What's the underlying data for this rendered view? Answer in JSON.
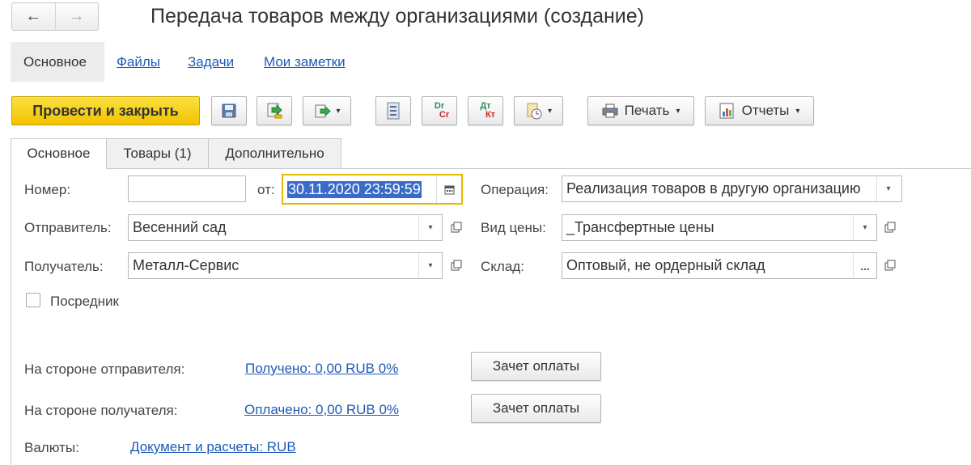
{
  "window": {
    "title": "Передача товаров между организациями (создание)",
    "nav": {
      "back_icon": "←",
      "forward_icon": "→"
    }
  },
  "section_tabs": [
    {
      "label": "Основное",
      "active": true
    },
    {
      "label": "Файлы"
    },
    {
      "label": "Задачи"
    },
    {
      "label": "Мои заметки"
    }
  ],
  "toolbar": {
    "post_close_label": "Провести и закрыть",
    "print_label": "Печать",
    "reports_label": "Отчеты",
    "dt_kt_top": "Dr",
    "dt_kt_bottom": "Cr",
    "dt_kt2_top": "Дт",
    "dt_kt2_bottom": "Кт",
    "dropdown_glyph": "▾",
    "colors": {
      "primary": "#f5c800",
      "dt": "#2e8b57",
      "kt": "#cc2222"
    }
  },
  "tabs": [
    {
      "label": "Основное",
      "active": true
    },
    {
      "label": "Товары (1)"
    },
    {
      "label": "Дополнительно"
    }
  ],
  "form": {
    "number": {
      "label": "Номер:",
      "value": ""
    },
    "date": {
      "label": "от:",
      "value": "30.11.2020 23:59:59"
    },
    "operation": {
      "label": "Операция:",
      "value": "Реализация товаров в другую организацию"
    },
    "sender": {
      "label": "Отправитель:",
      "value": "Весенний сад"
    },
    "price_type": {
      "label": "Вид цены:",
      "value": "_Трансфертные цены"
    },
    "receiver": {
      "label": "Получатель:",
      "value": "Металл-Сервис"
    },
    "warehouse": {
      "label": "Склад:",
      "value": "Оптовый, не ордерный склад",
      "select_glyph": "..."
    },
    "intermediary": {
      "label": "Посредник",
      "checked": false
    }
  },
  "settlements": {
    "sender_side": {
      "label": "На стороне отправителя:",
      "link": "Получено: 0,00 RUB  0%",
      "button": "Зачет оплаты"
    },
    "receiver_side": {
      "label": "На стороне получателя:",
      "link": "Оплачено: 0,00 RUB  0%",
      "button": "Зачет оплаты"
    },
    "currency": {
      "label": "Валюты:",
      "link": "Документ и расчеты: RUB"
    }
  },
  "colors": {
    "accent_link": "#1d5bb7",
    "focus_border": "#e6b800",
    "selection": "#3b6bc9"
  }
}
